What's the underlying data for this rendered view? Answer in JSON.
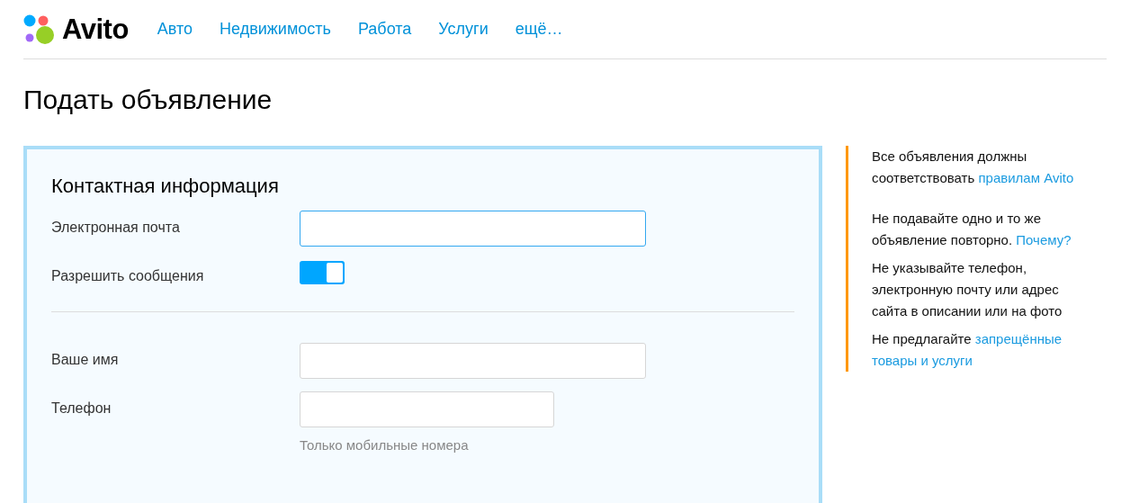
{
  "header": {
    "logo": "Avito",
    "nav": [
      {
        "label": "Авто"
      },
      {
        "label": "Недвижимость"
      },
      {
        "label": "Работа"
      },
      {
        "label": "Услуги"
      },
      {
        "label": "ещё…"
      }
    ]
  },
  "page_title": "Подать объявление",
  "form": {
    "section_title": "Контактная информация",
    "rows": [
      {
        "kind": "field",
        "label": "Электронная почта",
        "focused": true
      },
      {
        "kind": "toggle",
        "label": "Разрешить сообщения",
        "on": true
      },
      {
        "kind": "divider"
      },
      {
        "kind": "field",
        "label": "Ваше имя",
        "focused": false
      },
      {
        "kind": "shortfield",
        "label": "Телефон",
        "focused": false,
        "hint": "Только мобильные номера"
      }
    ]
  },
  "tips": [
    {
      "text": "Все объявления должны соответствовать ",
      "links": [
        "правилам Avito"
      ]
    },
    {
      "text": "Не подавайте одно и то же объявление повторно. ",
      "links": [
        "Почему?"
      ]
    },
    {
      "text": "Не указывайте телефон, электронную почту или адрес сайта в описании или на фото"
    },
    {
      "text": "Не предлагайте ",
      "links": [
        "запрещённые",
        "товары и услуги"
      ]
    }
  ]
}
